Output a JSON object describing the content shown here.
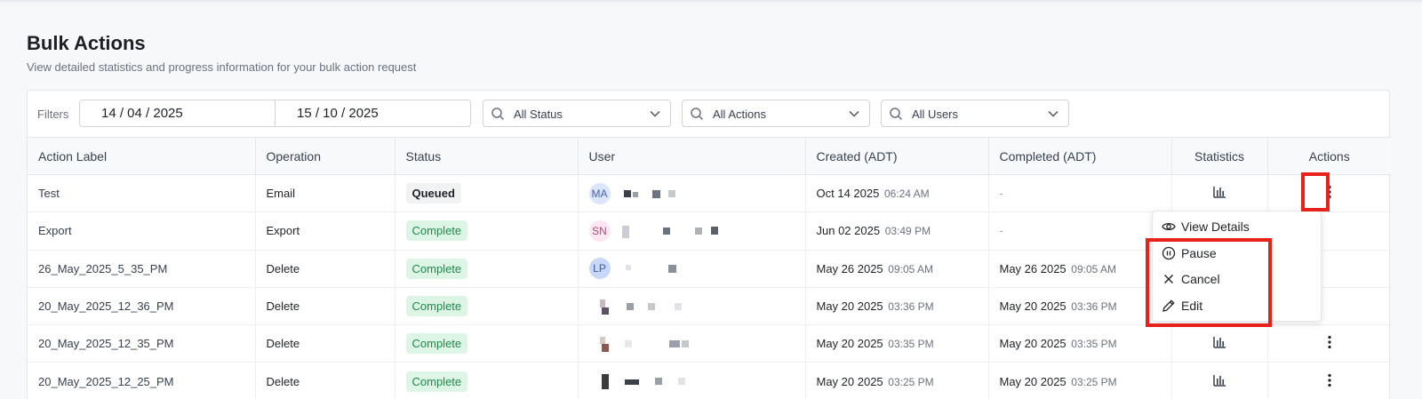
{
  "page": {
    "title": "Bulk Actions",
    "subtitle": "View detailed statistics and progress information for your bulk action request"
  },
  "filters": {
    "label": "Filters",
    "date_from": "14 / 04 / 2025",
    "date_to": "15 / 10 / 2025",
    "status_select": "All Status",
    "actions_select": "All Actions",
    "users_select": "All Users"
  },
  "table": {
    "headers": [
      "Action Label",
      "Operation",
      "Status",
      "User",
      "Created (ADT)",
      "Completed (ADT)",
      "Statistics",
      "Actions"
    ],
    "rows": [
      {
        "label": "Test",
        "operation": "Email",
        "status": "Queued",
        "avatar": "MA",
        "created_date": "Oct 14 2025",
        "created_time": "06:24 AM",
        "completed_date": "-",
        "completed_time": ""
      },
      {
        "label": "Export",
        "operation": "Export",
        "status": "Complete",
        "avatar": "SN",
        "created_date": "Jun 02 2025",
        "created_time": "03:49 PM",
        "completed_date": "-",
        "completed_time": ""
      },
      {
        "label": "26_May_2025_5_35_PM",
        "operation": "Delete",
        "status": "Complete",
        "avatar": "LP",
        "created_date": "May 26 2025",
        "created_time": "09:05 AM",
        "completed_date": "May 26 2025",
        "completed_time": "09:05 AM"
      },
      {
        "label": "20_May_2025_12_36_PM",
        "operation": "Delete",
        "status": "Complete",
        "avatar": "",
        "created_date": "May 20 2025",
        "created_time": "03:36 PM",
        "completed_date": "May 20 2025",
        "completed_time": "03:36 PM"
      },
      {
        "label": "20_May_2025_12_35_PM",
        "operation": "Delete",
        "status": "Complete",
        "avatar": "",
        "created_date": "May 20 2025",
        "created_time": "03:35 PM",
        "completed_date": "May 20 2025",
        "completed_time": "03:35 PM"
      },
      {
        "label": "20_May_2025_12_25_PM",
        "operation": "Delete",
        "status": "Complete",
        "avatar": "",
        "created_date": "May 20 2025",
        "created_time": "03:25 PM",
        "completed_date": "May 20 2025",
        "completed_time": "03:25 PM"
      }
    ]
  },
  "menu": {
    "view_details": "View Details",
    "pause": "Pause",
    "cancel": "Cancel",
    "edit": "Edit"
  },
  "icons": {
    "search": "search-icon",
    "chevron": "chevron-down-icon",
    "stats": "bar-chart-icon",
    "more": "kebab-menu-icon",
    "eye": "eye-icon",
    "pause": "pause-circle-icon",
    "close": "close-icon",
    "edit": "pencil-icon"
  },
  "colors": {
    "complete_bg": "#dcf5e4",
    "complete_text": "#1f8a4c",
    "queued_bg": "#f1f2f4",
    "highlight": "#e8221b"
  }
}
